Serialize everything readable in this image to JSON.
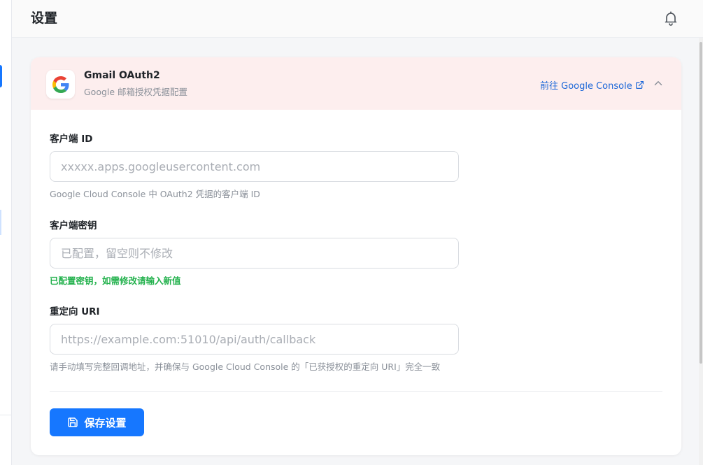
{
  "header": {
    "title": "设置",
    "notification_icon": "bell-icon"
  },
  "oauth_card": {
    "logo_icon": "google-logo-icon",
    "title": "Gmail OAuth2",
    "subtitle": "Google 邮箱授权凭据配置",
    "console_link": "前往 Google Console",
    "console_link_icon": "external-link-icon",
    "collapse_icon": "chevron-up-icon",
    "header_bg": "#fdeeee",
    "fields": {
      "client_id": {
        "label": "客户端 ID",
        "value": "",
        "placeholder": "xxxxx.apps.googleusercontent.com",
        "help": "Google Cloud Console 中 OAuth2 凭据的客户端 ID"
      },
      "client_secret": {
        "label": "客户端密钥",
        "value": "",
        "placeholder": "已配置，留空则不修改",
        "help": "已配置密钥，如需修改请输入新值",
        "help_color": "#22b14c"
      },
      "redirect_uri": {
        "label": "重定向 URI",
        "value": "",
        "placeholder": "https://example.com:51010/api/auth/callback",
        "help": "请手动填写完整回调地址，并确保与 Google Cloud Console 的「已获授权的重定向 URI」完全一致"
      }
    },
    "save_button": {
      "label": "保存设置",
      "icon": "save-icon",
      "color": "#1677ff"
    }
  }
}
